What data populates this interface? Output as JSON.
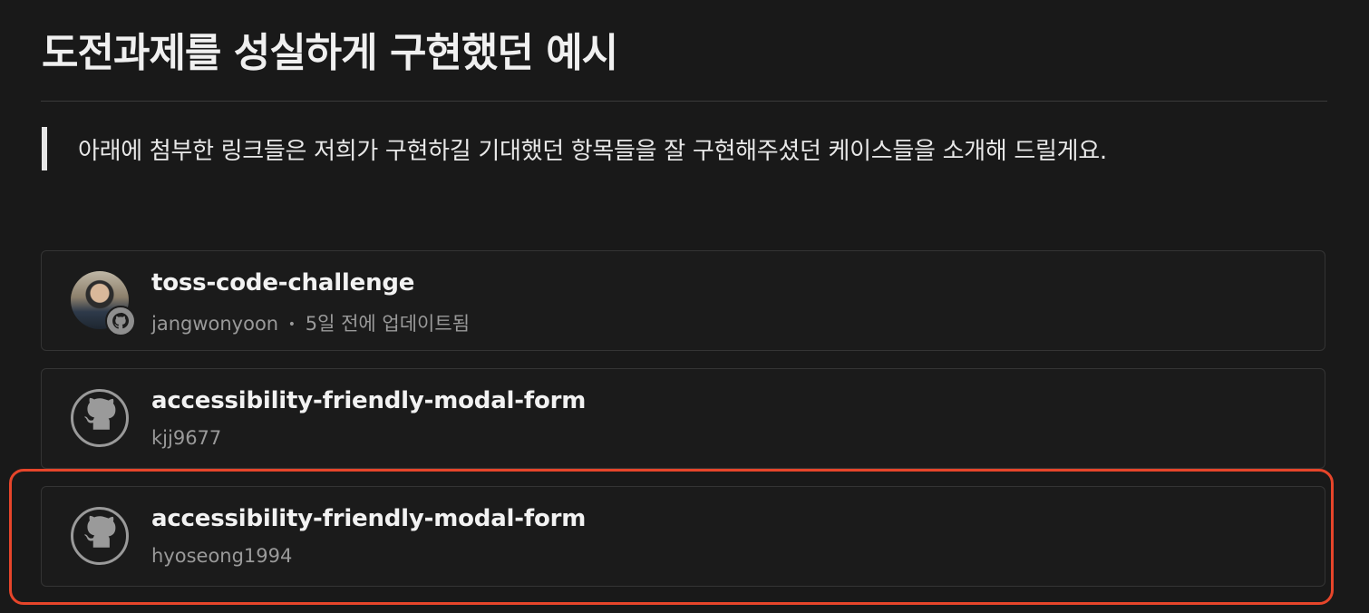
{
  "heading": "도전과제를 성실하게 구현했던 예시",
  "callout": "아래에 첨부한 링크들은 저희가 구현하길 기대했던 항목들을 잘 구현해주셨던 케이스들을 소개해 드릴게요.",
  "cards": [
    {
      "title": "toss-code-challenge",
      "author": "jangwonyoon",
      "separator": "•",
      "updated": "5일 전에 업데이트됨",
      "avatar": "user-photo"
    },
    {
      "title": "accessibility-friendly-modal-form",
      "author": "kjj9677",
      "avatar": "github-icon"
    },
    {
      "title": "accessibility-friendly-modal-form",
      "author": "hyoseong1994",
      "avatar": "github-icon"
    }
  ],
  "colors": {
    "background": "#191919",
    "highlight": "#e6452a",
    "card_border": "#343434"
  }
}
